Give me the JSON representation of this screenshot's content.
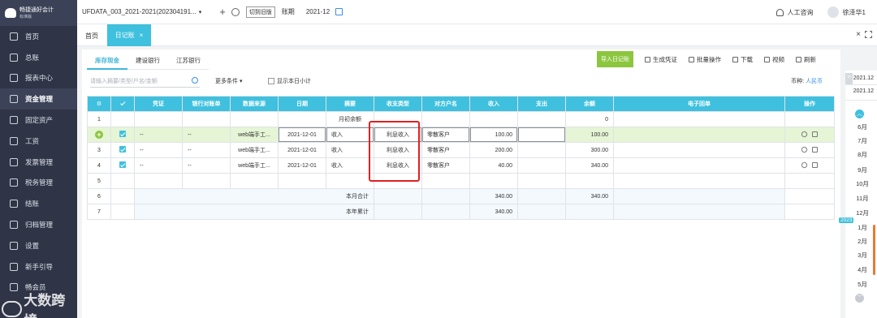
{
  "app": {
    "name": "畅捷通好会计",
    "edition": "标准版"
  },
  "sidebar": {
    "items": [
      {
        "label": "首页"
      },
      {
        "label": "总账"
      },
      {
        "label": "报表中心"
      },
      {
        "label": "资金管理"
      },
      {
        "label": "固定资产"
      },
      {
        "label": "工资"
      },
      {
        "label": "发票管理"
      },
      {
        "label": "税务管理"
      },
      {
        "label": "结账"
      },
      {
        "label": "归档管理"
      },
      {
        "label": "设置"
      },
      {
        "label": "新手引导"
      },
      {
        "label": "畅会员"
      }
    ],
    "active_index": 3
  },
  "watermark": {
    "text": "大数跨境"
  },
  "topbar": {
    "account": "UFDATA_003_2021-2021(202304191...",
    "switch_label": "切到旧版",
    "period_label": "账期",
    "period_value": "2021-12",
    "support_label": "人工咨询",
    "user_name": "徐泽华1"
  },
  "tabs": {
    "home": "首页",
    "active": "日记账",
    "close": "×"
  },
  "bank_tabs": [
    "库存现金",
    "建设银行",
    "江苏银行"
  ],
  "actions": {
    "import": "导入日记账",
    "gen_voucher": "生成凭证",
    "batch": "批量操作",
    "download": "下载",
    "video": "视频",
    "refresh": "刷新"
  },
  "filter": {
    "search_placeholder": "请输入摘要/类型/户名/金额",
    "more_conditions": "更多条件",
    "daily_subtotal": "显示本日小计",
    "currency_label": "币种:",
    "currency_value": "人民币"
  },
  "table": {
    "headers": [
      "凭证",
      "银行对账单",
      "数据来源",
      "日期",
      "摘要",
      "收支类型",
      "对方户名",
      "收入",
      "支出",
      "余额",
      "电子回单",
      "操作"
    ],
    "rows": [
      {
        "no": "1",
        "summary": "月初余额",
        "balance": "0"
      },
      {
        "no": "2",
        "voucher": "--",
        "bank_stmt": "--",
        "source": "web端手工...",
        "date": "2021-12-01",
        "summary": "收入",
        "type": "利息收入",
        "party": "零散客户",
        "income": "100.00",
        "expense": "",
        "balance": "100.00"
      },
      {
        "no": "3",
        "voucher": "--",
        "bank_stmt": "--",
        "source": "web端手工...",
        "date": "2021-12-01",
        "summary": "收入",
        "type": "利息收入",
        "party": "零散客户",
        "income": "200.00",
        "expense": "",
        "balance": "300.00"
      },
      {
        "no": "4",
        "voucher": "--",
        "bank_stmt": "--",
        "source": "web端手工...",
        "date": "2021-12-01",
        "summary": "收入",
        "type": "利息收入",
        "party": "零散客户",
        "income": "40.00",
        "expense": "",
        "balance": "340.00"
      },
      {
        "no": "5"
      },
      {
        "no": "6",
        "summary": "本月合计",
        "income": "340.00",
        "balance": "340.00"
      },
      {
        "no": "7",
        "summary": "本年累计",
        "income": "340.00"
      }
    ]
  },
  "period_panel": {
    "collapse": ">",
    "heads": [
      "2021.12",
      "2021.12"
    ],
    "months_top": [
      "6月",
      "7月",
      "8月",
      "9月",
      "10月",
      "11月",
      "12月"
    ],
    "year_badge": "2023",
    "months_bottom": [
      "1月",
      "2月",
      "3月",
      "4月",
      "5月"
    ]
  }
}
